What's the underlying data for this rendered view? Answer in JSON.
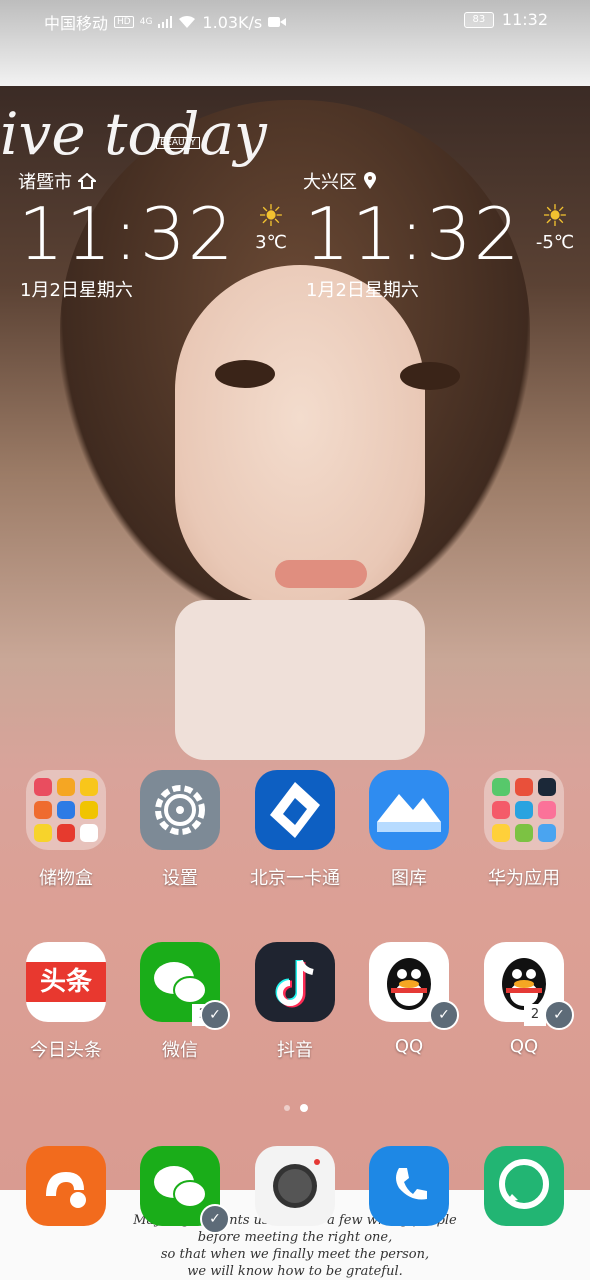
{
  "status_bar": {
    "carrier": "中国移动",
    "hd": "HD",
    "network": "4G",
    "speed": "1.03K/s",
    "battery": "83",
    "time": "11:32"
  },
  "wallpaper": {
    "script_text": "ive today",
    "brand_tag": "BEAUTY",
    "quote_lines": [
      "Maybe god wants us to meet a few wrong people",
      "before meeting the right one,",
      "so that when we finally meet the person,",
      "we will know how to be grateful."
    ]
  },
  "clock_left": {
    "city": "诸暨市",
    "time": "11:32",
    "date": "1月2日星期六",
    "temp": "3℃"
  },
  "clock_right": {
    "city": "大兴区",
    "time": "11:32",
    "date": "1月2日星期六",
    "temp": "-5℃"
  },
  "apps_row1": [
    {
      "label": "储物盒"
    },
    {
      "label": "设置"
    },
    {
      "label": "北京一卡通"
    },
    {
      "label": "图库"
    },
    {
      "label": "华为应用"
    }
  ],
  "apps_row2": [
    {
      "label": "今日头条",
      "icon_text": "头条"
    },
    {
      "label": "微信"
    },
    {
      "label": "抖音"
    },
    {
      "label": "QQ"
    },
    {
      "label": "QQ"
    }
  ],
  "clone_badge": "2",
  "colors": {
    "wechat_green": "#1aad19",
    "uc_orange": "#f26b1d",
    "phone_blue": "#1e88e5",
    "messages_green": "#22b573",
    "toutiao_red": "#e8382f"
  }
}
